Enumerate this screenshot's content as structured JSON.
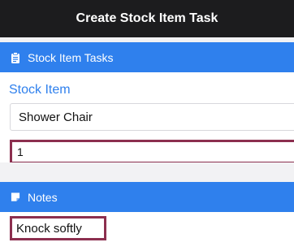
{
  "header": {
    "title": "Create Stock Item Task"
  },
  "stock_section": {
    "title": "Stock Item Tasks",
    "icon": "clipboard-icon",
    "field_label": "Stock Item",
    "stock_item_value": "Shower Chair",
    "quantity_value": "1"
  },
  "notes_section": {
    "title": "Notes",
    "icon": "note-icon",
    "notes_value": "Knock softly"
  },
  "colors": {
    "header_bg": "#1c1c1e",
    "section_bg": "#2f80ed",
    "label_blue": "#2f80ed",
    "highlight_border": "#8c2f4f"
  }
}
